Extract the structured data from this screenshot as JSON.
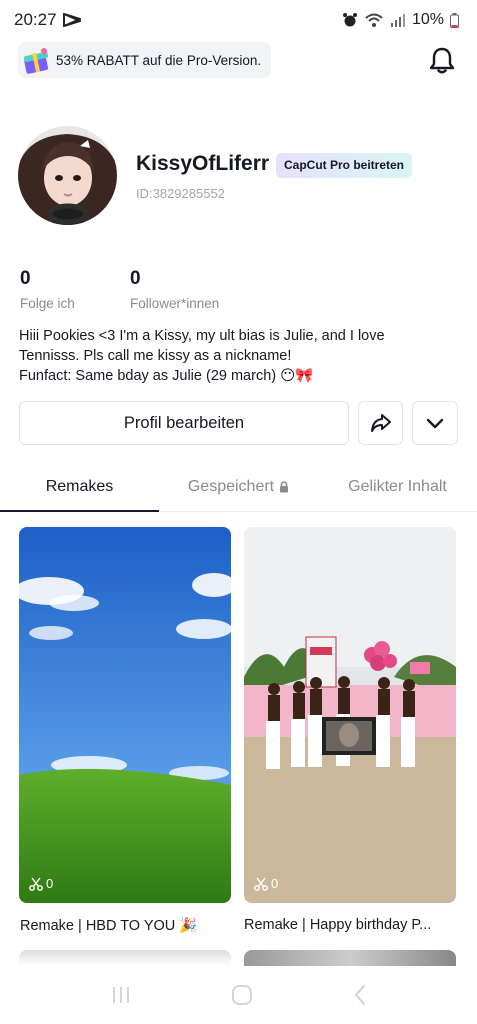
{
  "status": {
    "time": "20:27",
    "battery": "10%"
  },
  "promo": {
    "text": "53% RABATT auf die Pro-Version."
  },
  "profile": {
    "username": "KissyOfLiferr",
    "pro_badge": "CapCut Pro beitreten",
    "user_id": "ID:3829285552"
  },
  "stats": [
    {
      "value": "0",
      "label": "Folge ich"
    },
    {
      "value": "0",
      "label": "Follower*innen"
    }
  ],
  "bio": {
    "line1": "Hiii Pookies <3 I'm a Kissy, my ult bias is Julie, and I love",
    "line2": "Tennisss. Pls call me kissy as a nickname!",
    "line3": "Funfact: Same bday as Julie (29 march) 😶🎀"
  },
  "actions": {
    "edit_label": "Profil bearbeiten"
  },
  "tabs": [
    {
      "label": "Remakes",
      "active": true
    },
    {
      "label": "Gespeichert",
      "active": false
    },
    {
      "label": "Gelikter Inhalt",
      "active": false
    }
  ],
  "cards": [
    {
      "count": "0",
      "title": "Remake | HBD TO YOU 🎉"
    },
    {
      "count": "0",
      "title": "Remake | Happy birthday P..."
    }
  ],
  "colors": {
    "text": "#161823",
    "muted": "#8a8b91",
    "badge_from": "#e6e0ff",
    "badge_to": "#d8f6f3"
  }
}
